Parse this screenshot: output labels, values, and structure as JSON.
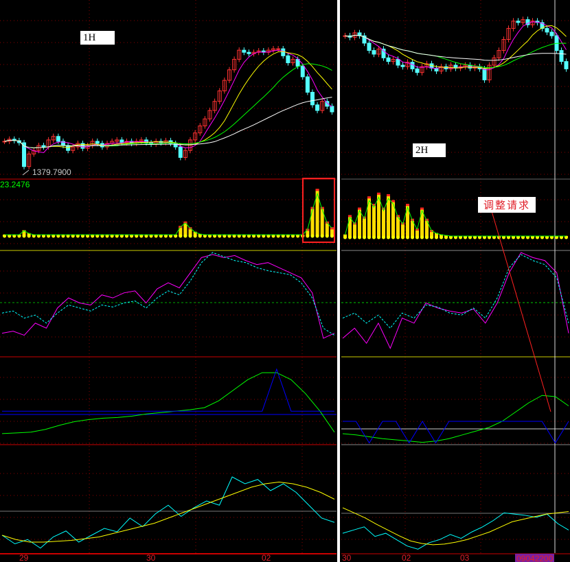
{
  "labels": {
    "left_timeframe": "1H",
    "right_timeframe": "2H",
    "low_price": "1379.7900",
    "indicator_value": "23.2476",
    "annotation": "调整请求",
    "time_cursor": "09042200"
  },
  "x_axis": {
    "left": [
      "29",
      "30",
      "02"
    ],
    "right": [
      "30",
      "02",
      "03"
    ]
  },
  "colors": {
    "up": "#ff3232",
    "down": "#54ffff",
    "ma": [
      "#ffffff",
      "#ffff00",
      "#00ff00",
      "#ff00ff"
    ],
    "grid": "#8b0000",
    "accent": "#ff0000"
  },
  "chart_data": [
    {
      "type": "candlestick",
      "panel": "left-price",
      "ylim": [
        1370,
        1600
      ],
      "closes": [
        1418,
        1421,
        1419,
        1416,
        1382,
        1400,
        1405,
        1412,
        1410,
        1420,
        1425,
        1418,
        1412,
        1405,
        1410,
        1415,
        1408,
        1412,
        1418,
        1415,
        1410,
        1415,
        1418,
        1420,
        1416,
        1418,
        1415,
        1418,
        1420,
        1416,
        1414,
        1418,
        1416,
        1419,
        1415,
        1410,
        1395,
        1405,
        1420,
        1430,
        1440,
        1450,
        1462,
        1475,
        1490,
        1505,
        1520,
        1535,
        1548,
        1545,
        1543,
        1545,
        1547,
        1545,
        1548,
        1550,
        1550,
        1540,
        1530,
        1535,
        1525,
        1510,
        1488,
        1470,
        1462,
        1475,
        1468,
        1460
      ]
    },
    {
      "type": "candlestick",
      "panel": "right-price",
      "ylim": [
        1420,
        1560
      ],
      "closes": [
        1530,
        1528,
        1534,
        1530,
        1520,
        1510,
        1505,
        1512,
        1500,
        1495,
        1498,
        1490,
        1488,
        1494,
        1485,
        1480,
        1488,
        1492,
        1486,
        1482,
        1488,
        1485,
        1490,
        1486,
        1488,
        1490,
        1486,
        1488,
        1485,
        1470,
        1490,
        1500,
        1510,
        1525,
        1540,
        1550,
        1548,
        1552,
        1545,
        1550,
        1548,
        1540,
        1535,
        1530,
        1510,
        1495,
        1485
      ]
    },
    {
      "type": "bar",
      "panel": "left-volume",
      "values": [
        2,
        2,
        2,
        2,
        8,
        4,
        2,
        2,
        2,
        2,
        2,
        2,
        2,
        2,
        2,
        2,
        2,
        2,
        2,
        2,
        2,
        2,
        2,
        2,
        2,
        2,
        2,
        2,
        2,
        2,
        2,
        2,
        2,
        2,
        2,
        2,
        14,
        20,
        12,
        6,
        3,
        2,
        2,
        2,
        2,
        2,
        2,
        2,
        2,
        2,
        2,
        2,
        2,
        2,
        2,
        2,
        2,
        2,
        2,
        2,
        2,
        2,
        10,
        40,
        65,
        40,
        20,
        12
      ]
    },
    {
      "type": "bar",
      "panel": "right-volume",
      "values": [
        4,
        30,
        20,
        40,
        28,
        55,
        45,
        60,
        40,
        58,
        50,
        30,
        20,
        45,
        25,
        12,
        40,
        25,
        10,
        6,
        4,
        3,
        2,
        2,
        2,
        2,
        2,
        2,
        2,
        2,
        2,
        2,
        2,
        2,
        2,
        2,
        2,
        2,
        2,
        2,
        2,
        2,
        2,
        2,
        2,
        2,
        2
      ]
    },
    {
      "type": "line",
      "panel": "left-osc",
      "ylim": [
        0,
        100
      ],
      "series": [
        {
          "name": "solid",
          "color": "#ff00ff",
          "values": [
            20,
            22,
            18,
            30,
            25,
            45,
            55,
            50,
            48,
            58,
            55,
            60,
            62,
            50,
            64,
            70,
            65,
            80,
            95,
            98,
            95,
            97,
            92,
            88,
            90,
            85,
            80,
            75,
            60,
            15,
            20
          ]
        },
        {
          "name": "dashed",
          "color": "#00ffff",
          "values": [
            40,
            42,
            35,
            38,
            30,
            40,
            48,
            45,
            42,
            48,
            46,
            50,
            52,
            45,
            55,
            62,
            58,
            72,
            90,
            100,
            96,
            92,
            90,
            85,
            82,
            80,
            78,
            70,
            55,
            25,
            18
          ]
        }
      ]
    },
    {
      "type": "line",
      "panel": "right-osc",
      "ylim": [
        0,
        100
      ],
      "series": [
        {
          "name": "solid",
          "color": "#ff00ff",
          "values": [
            15,
            25,
            10,
            30,
            5,
            35,
            30,
            50,
            45,
            42,
            40,
            44,
            30,
            50,
            80,
            100,
            95,
            92,
            80,
            20
          ]
        },
        {
          "name": "dashed",
          "color": "#00ffff",
          "values": [
            35,
            40,
            30,
            38,
            25,
            40,
            35,
            48,
            46,
            40,
            38,
            45,
            35,
            55,
            85,
            98,
            92,
            88,
            75,
            30
          ]
        }
      ]
    },
    {
      "type": "line",
      "panel": "left-trend",
      "ylim": [
        0,
        100
      ],
      "series": [
        {
          "name": "green",
          "color": "#00ff00",
          "values": [
            8,
            9,
            10,
            14,
            20,
            25,
            28,
            30,
            31,
            33,
            36,
            38,
            40,
            42,
            45,
            55,
            70,
            85,
            95,
            95,
            85,
            65,
            40,
            10
          ]
        },
        {
          "name": "blue",
          "color": "#0000ff",
          "values": [
            40,
            40,
            40,
            40,
            40,
            40,
            40,
            40,
            40,
            40,
            40,
            40,
            40,
            40,
            40,
            40,
            40,
            40,
            40,
            100,
            40,
            40,
            40,
            40
          ]
        }
      ]
    },
    {
      "type": "line",
      "panel": "right-trend",
      "ylim": [
        0,
        100
      ],
      "series": [
        {
          "name": "green",
          "color": "#00ff00",
          "values": [
            20,
            18,
            15,
            12,
            10,
            8,
            6,
            8,
            12,
            18,
            24,
            30,
            40,
            55,
            70,
            82,
            80,
            65
          ]
        },
        {
          "name": "blue",
          "color": "#0000ff",
          "values": [
            40,
            40,
            5,
            40,
            40,
            5,
            40,
            5,
            40,
            40,
            40,
            40,
            40,
            40,
            40,
            40,
            5,
            40
          ]
        }
      ]
    },
    {
      "type": "line",
      "panel": "left-bottom",
      "ylim": [
        0,
        100
      ],
      "series": [
        {
          "name": "cyan",
          "color": "#00ffff",
          "values": [
            20,
            10,
            15,
            5,
            18,
            25,
            12,
            20,
            28,
            24,
            40,
            30,
            45,
            55,
            42,
            52,
            60,
            55,
            88,
            80,
            85,
            72,
            80,
            70,
            55,
            40,
            35
          ]
        },
        {
          "name": "yellow",
          "color": "#ffff00",
          "values": [
            20,
            15,
            12,
            12,
            13,
            14,
            16,
            18,
            22,
            26,
            30,
            34,
            40,
            46,
            52,
            58,
            64,
            70,
            76,
            80,
            82,
            80,
            76,
            70,
            62
          ]
        }
      ]
    },
    {
      "type": "line",
      "panel": "right-bottom",
      "ylim": [
        0,
        100
      ],
      "series": [
        {
          "name": "cyan",
          "color": "#00ffff",
          "values": [
            30,
            35,
            40,
            25,
            30,
            20,
            10,
            5,
            15,
            20,
            28,
            22,
            32,
            40,
            50,
            62,
            60,
            58,
            55,
            60,
            45,
            35
          ]
        },
        {
          "name": "yellow",
          "color": "#ffff00",
          "values": [
            70,
            62,
            54,
            44,
            35,
            26,
            18,
            14,
            12,
            13,
            16,
            20,
            26,
            32,
            40,
            48,
            52,
            56,
            60,
            62,
            64
          ]
        }
      ]
    }
  ]
}
